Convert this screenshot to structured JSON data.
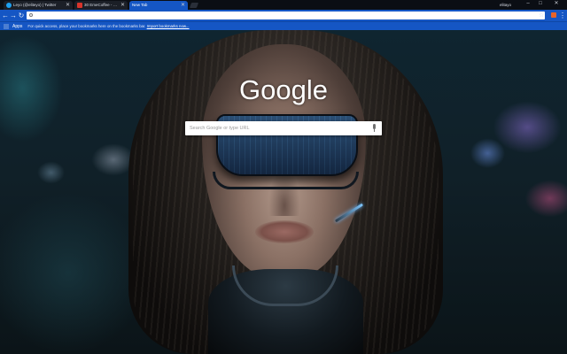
{
  "tabs": [
    {
      "title": "Leyo (@eliteyo) | Twitter",
      "favicon": "twitter-icon",
      "active": false
    },
    {
      "title": "30 EmeCoffee - Populo",
      "favicon": "red-page-icon",
      "active": false
    },
    {
      "title": "New Tab",
      "favicon": "",
      "active": true
    }
  ],
  "window": {
    "profile_name": "elitayo",
    "minimize": "–",
    "maximize": "□",
    "close": "✕"
  },
  "toolbar": {
    "back": "←",
    "forward": "→",
    "reload": "↻",
    "omnibox_value": "",
    "star": "☆",
    "menu": "⋮"
  },
  "bookmarks": {
    "apps_label": "Apps",
    "hint_text": "For quick access, place your bookmarks here on the bookmarks bar.",
    "import_link": "Import bookmarks now..."
  },
  "ntp": {
    "logo_text": "Google",
    "search_placeholder": "Search Google or type URL"
  },
  "colors": {
    "accent": "#1556c4",
    "tabstrip": "#0b0e14"
  }
}
